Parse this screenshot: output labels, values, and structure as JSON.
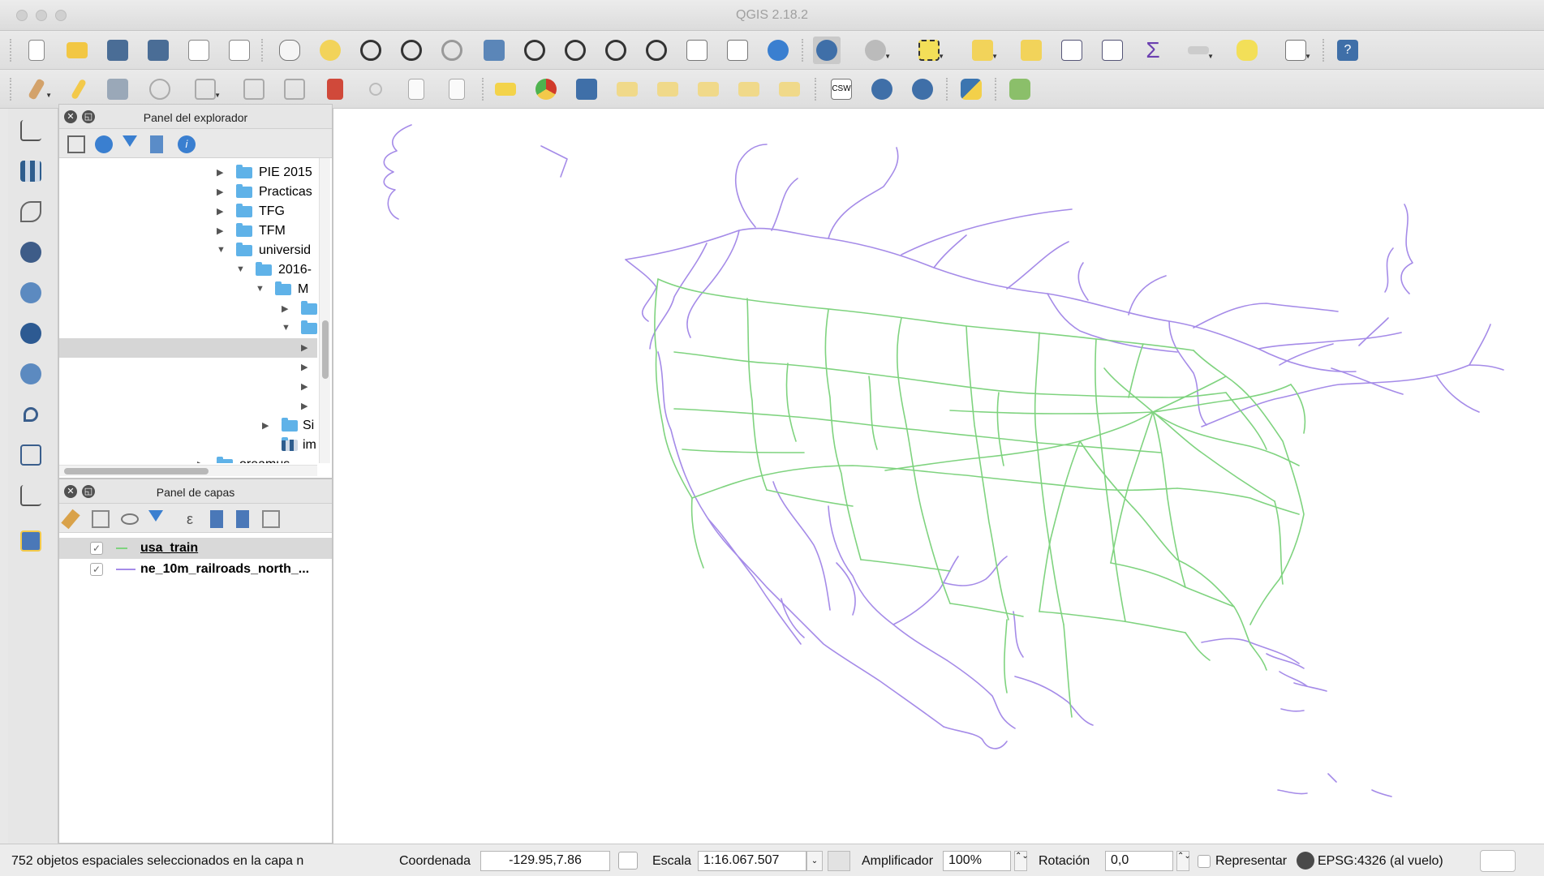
{
  "window": {
    "title": "QGIS 2.18.2"
  },
  "browser_panel": {
    "title": "Panel del explorador"
  },
  "tree": [
    {
      "label": "PIE 2015",
      "expanded": false
    },
    {
      "label": "Practicas",
      "expanded": false
    },
    {
      "label": "TFG",
      "expanded": false
    },
    {
      "label": "TFM",
      "expanded": false
    },
    {
      "label": "universid",
      "expanded": true
    },
    {
      "label": "2016-",
      "expanded": true
    },
    {
      "label": "M",
      "expanded": true
    },
    {
      "label": "",
      "expanded": false
    },
    {
      "label": "",
      "expanded": true
    },
    {
      "label": "",
      "expanded": false
    },
    {
      "label": "",
      "expanded": false
    },
    {
      "label": "",
      "expanded": false
    },
    {
      "label": "",
      "expanded": false
    },
    {
      "label": "Si",
      "expanded": false
    },
    {
      "label": "im",
      "expanded": false
    },
    {
      "label": "oreamus",
      "expanded": false
    }
  ],
  "layers_panel": {
    "title": "Panel de capas"
  },
  "layers": [
    {
      "name": "usa_train",
      "checked": true,
      "color": "#7fd37f"
    },
    {
      "name": "ne_10m_railroads_north_...",
      "checked": true,
      "color": "#a58be8"
    }
  ],
  "status": {
    "message": "752 objetos espaciales seleccionados en la capa n",
    "coord_label": "Coordenada",
    "coord_value": "-129.95,7.86",
    "scale_label": "Escala",
    "scale_value": "1:16.067.507",
    "magnifier_label": "Amplificador",
    "magnifier_value": "100%",
    "rotation_label": "Rotación",
    "rotation_value": "0,0",
    "render_label": "Representar",
    "crs": "EPSG:4326 (al vuelo)"
  },
  "colors": {
    "usa_train": "#7fd37f",
    "railroads": "#a58be8",
    "accent": "#3a7fd0"
  },
  "toolbar1_icons": [
    "new-project-icon",
    "open-project-icon",
    "save-project-icon",
    "save-as-icon",
    "new-print-composer-icon",
    "composer-manager-icon",
    "pan-icon",
    "pan-to-selection-icon",
    "zoom-in-icon",
    "zoom-out-icon",
    "zoom-native-icon",
    "zoom-full-icon",
    "zoom-to-selection-icon",
    "zoom-to-layer-icon",
    "zoom-last-icon",
    "zoom-next-icon",
    "new-map-view-icon",
    "new-bookmark-icon",
    "refresh-icon",
    "identify-icon",
    "action-icon",
    "select-icon",
    "select-expression-icon",
    "deselect-icon",
    "attribute-table-icon",
    "field-calculator-icon",
    "statistics-icon",
    "measure-icon",
    "map-tips-icon",
    "text-annotation-icon",
    "help-icon"
  ],
  "toolbar2_icons": [
    "current-edits-icon",
    "toggle-editing-icon",
    "save-edits-icon",
    "add-feature-icon",
    "node-tool-icon",
    "add-part-icon",
    "simplify-icon",
    "delete-icon",
    "cut-icon",
    "copy-icon",
    "paste-icon",
    "label-icon",
    "diagram-icon",
    "layer-labeling-icon",
    "pin-labels-icon",
    "show-hide-labels-icon",
    "move-label-icon",
    "rotate-label-icon",
    "change-label-icon",
    "csw-icon",
    "metasearch-icon",
    "geosearch-icon",
    "python-icon",
    "plugin-icon"
  ],
  "left_icons": [
    "add-vector-layer-icon",
    "add-raster-layer-icon",
    "add-spatialite-icon",
    "add-postgis-icon",
    "add-wms-icon",
    "add-wcs-icon",
    "add-wfs-icon",
    "add-delimited-icon",
    "add-virtual-layer-icon",
    "new-layer-icon",
    "new-temporary-layer-icon"
  ]
}
